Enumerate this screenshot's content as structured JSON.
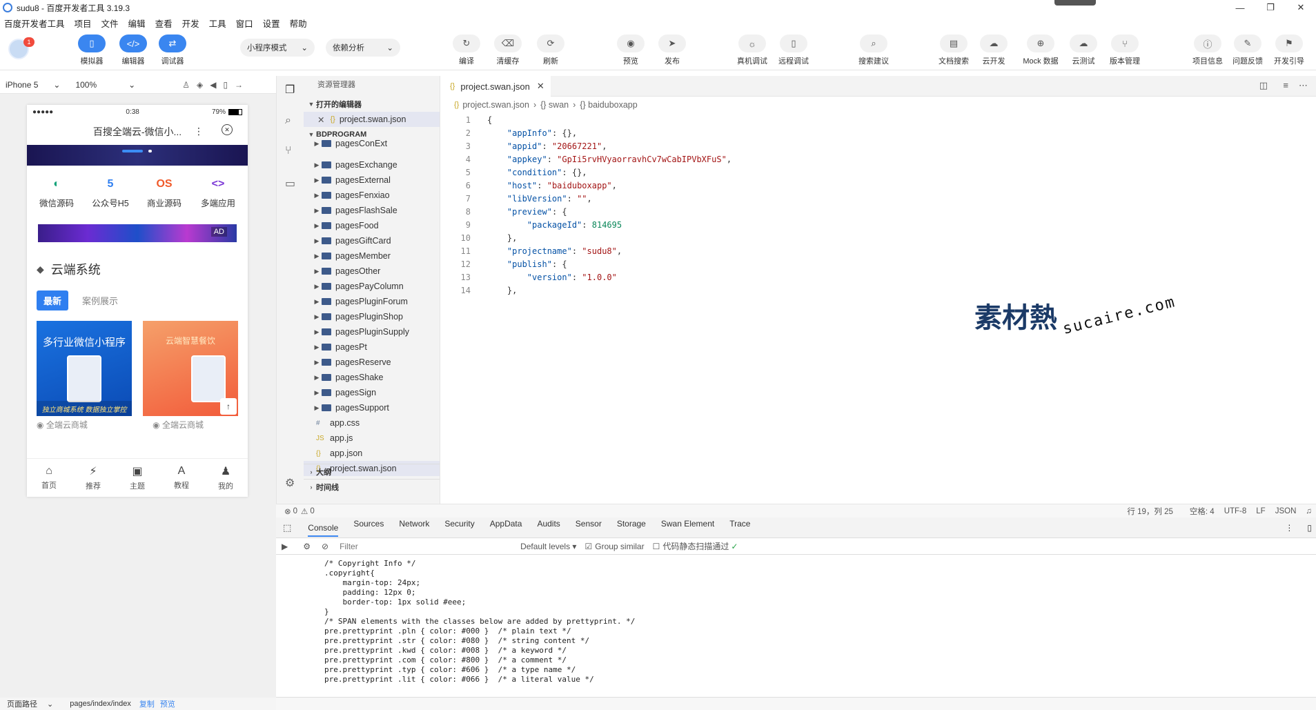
{
  "window": {
    "title": "sudu8 - 百度开发者工具 3.19.3",
    "min": "—",
    "max": "❐",
    "close": "✕"
  },
  "menu": [
    "百度开发者工具",
    "项目",
    "文件",
    "编辑",
    "查看",
    "开发",
    "工具",
    "窗口",
    "设置",
    "帮助"
  ],
  "user": {
    "badge": "1"
  },
  "toolbar": {
    "left_buttons": [
      {
        "icon": "simulator-icon",
        "glyph": "▯",
        "label": "模拟器"
      },
      {
        "icon": "editor-icon",
        "glyph": "</>",
        "label": "编辑器"
      },
      {
        "icon": "debugger-icon",
        "glyph": "⇄",
        "label": "调试器"
      }
    ],
    "mode_select": "小程序模式",
    "dep_select": "依赖分析",
    "actions": [
      {
        "icon": "compile-icon",
        "glyph": "↻",
        "label": "编译"
      },
      {
        "icon": "clear-cache-icon",
        "glyph": "⌫",
        "label": "清缓存"
      },
      {
        "icon": "refresh-icon",
        "glyph": "⟳",
        "label": "刷新"
      },
      {
        "icon": "preview-icon",
        "glyph": "◉",
        "label": "预览"
      },
      {
        "icon": "publish-icon",
        "glyph": "➤",
        "label": "发布"
      },
      {
        "icon": "real-device-debug-icon",
        "glyph": "☼",
        "label": "真机调试"
      },
      {
        "icon": "remote-debug-icon",
        "glyph": "▯",
        "label": "远程调试"
      },
      {
        "icon": "search-suggest-icon",
        "glyph": "⌕",
        "label": "搜索建议"
      },
      {
        "icon": "doc-search-icon",
        "glyph": "▤",
        "label": "文档搜索"
      },
      {
        "icon": "cloud-dev-icon",
        "glyph": "☁",
        "label": "云开发"
      },
      {
        "icon": "mock-data-icon",
        "glyph": "⊕",
        "label": "Mock 数据"
      },
      {
        "icon": "cloud-test-icon",
        "glyph": "☁",
        "label": "云测试"
      },
      {
        "icon": "version-icon",
        "glyph": "⑂",
        "label": "版本管理"
      },
      {
        "icon": "project-info-icon",
        "glyph": "ⓘ",
        "label": "项目信息"
      },
      {
        "icon": "feedback-icon",
        "glyph": "✎",
        "label": "问题反馈"
      },
      {
        "icon": "dev-guide-icon",
        "glyph": "⚑",
        "label": "开发引导"
      }
    ]
  },
  "simulator": {
    "device": "iPhone 5",
    "zoom": "100%",
    "status": {
      "signal": "●●●●● ",
      "time": "0:38",
      "battery": "79%"
    },
    "nav_title": "百搜全端云-微信小...",
    "icons": [
      {
        "icon": "wechat-source-icon",
        "glyph": "◐",
        "color": "#16a37a",
        "label": "微信源码"
      },
      {
        "icon": "h5-icon",
        "glyph": "5",
        "color": "#2f7ff0",
        "label": "公众号H5"
      },
      {
        "icon": "commercial-source-icon",
        "glyph": "OS",
        "color": "#f05a2a",
        "label": "商业源码"
      },
      {
        "icon": "multi-platform-icon",
        "glyph": "<>",
        "color": "#7a35d6",
        "label": "多端应用"
      }
    ],
    "ad_label": "AD",
    "section_title": "云端系统",
    "tabs": {
      "active": "最新",
      "inactive": "案例展示"
    },
    "cards": [
      {
        "title": "多行业微信小程序",
        "bottom": "独立商城系统 数据独立掌控",
        "caption": "全端云商城"
      },
      {
        "title": "云端智慧餐饮",
        "bottom": "",
        "caption": "全端云商城"
      }
    ],
    "tabbar": [
      {
        "icon": "home-icon",
        "glyph": "⌂",
        "label": "首页"
      },
      {
        "icon": "recommend-icon",
        "glyph": "⚡",
        "label": "推荐"
      },
      {
        "icon": "topic-icon",
        "glyph": "▣",
        "label": "主题"
      },
      {
        "icon": "tutorial-icon",
        "glyph": "A",
        "label": "教程"
      },
      {
        "icon": "mine-icon",
        "glyph": "♟",
        "label": "我的"
      }
    ],
    "page_path_label": "页面路径",
    "page_path": "pages/index/index",
    "copy": "复制",
    "preview": "预览"
  },
  "explorer": {
    "title": "资源管理器",
    "open_editors": "打开的编辑器",
    "open_file": "project.swan.json",
    "root": "BDPROGRAM",
    "folders": [
      "pagesConExt",
      "pagesExchange",
      "pagesExternal",
      "pagesFenxiao",
      "pagesFlashSale",
      "pagesFood",
      "pagesGiftCard",
      "pagesMember",
      "pagesOther",
      "pagesPayColumn",
      "pagesPluginForum",
      "pagesPluginShop",
      "pagesPluginSupply",
      "pagesPt",
      "pagesReserve",
      "pagesShake",
      "pagesSign",
      "pagesSupport"
    ],
    "files": [
      {
        "name": "app.css",
        "glyph": "#",
        "color": "#6b7f9a"
      },
      {
        "name": "app.js",
        "glyph": "JS",
        "color": "#c9a92a"
      },
      {
        "name": "app.json",
        "glyph": "{}",
        "color": "#c9a92a"
      },
      {
        "name": "project.swan.json",
        "glyph": "{}",
        "color": "#c9a92a"
      }
    ],
    "outline": "大纲",
    "timeline": "时间线"
  },
  "editor": {
    "tab": "project.swan.json",
    "breadcrumb": [
      "project.swan.json",
      "{} swan",
      "{} baiduboxapp"
    ],
    "lines": [
      "{",
      "    \"appInfo\": {},",
      "    \"appid\": \"20667221\",",
      "    \"appkey\": \"GpIi5rvHVyaorravhCv7wCabIPVbXFuS\",",
      "    \"condition\": {},",
      "    \"host\": \"baiduboxapp\",",
      "    \"libVersion\": \"\",",
      "    \"preview\": {",
      "        \"packageId\": 814695",
      "    },",
      "    \"projectname\": \"sudu8\",",
      "    \"publish\": {",
      "        \"version\": \"1.0.0\"",
      "    },"
    ],
    "status": {
      "errors": "0",
      "warnings": "0",
      "position": "行 19，列 25",
      "spaces": "空格: 4",
      "encoding": "UTF-8",
      "eol": "LF",
      "lang": "JSON"
    }
  },
  "watermark": {
    "cn": "素材熱",
    "en": "sucaire.com"
  },
  "devtools": {
    "tabs": [
      "Console",
      "Sources",
      "Network",
      "Security",
      "AppData",
      "Audits",
      "Sensor",
      "Storage",
      "Swan Element",
      "Trace"
    ],
    "filter_placeholder": "Filter",
    "levels": "Default levels ▾",
    "group_similar": "Group similar",
    "static_scan": "代码静态扫描通过",
    "console_lines": [
      "/* Copyright Info */",
      ".copyright{",
      "    margin-top: 24px;",
      "    padding: 12px 0;",
      "    border-top: 1px solid #eee;",
      "}",
      "",
      "/* SPAN elements with the classes below are added by prettyprint. */",
      "pre.prettyprint .pln { color: #000 }  /* plain text */",
      "pre.prettyprint .str { color: #080 }  /* string content */",
      "pre.prettyprint .kwd { color: #008 }  /* a keyword */",
      "pre.prettyprint .com { color: #800 }  /* a comment */",
      "pre.prettyprint .typ { color: #606 }  /* a type name */",
      "pre.prettyprint .lit { color: #066 }  /* a literal value */"
    ]
  }
}
